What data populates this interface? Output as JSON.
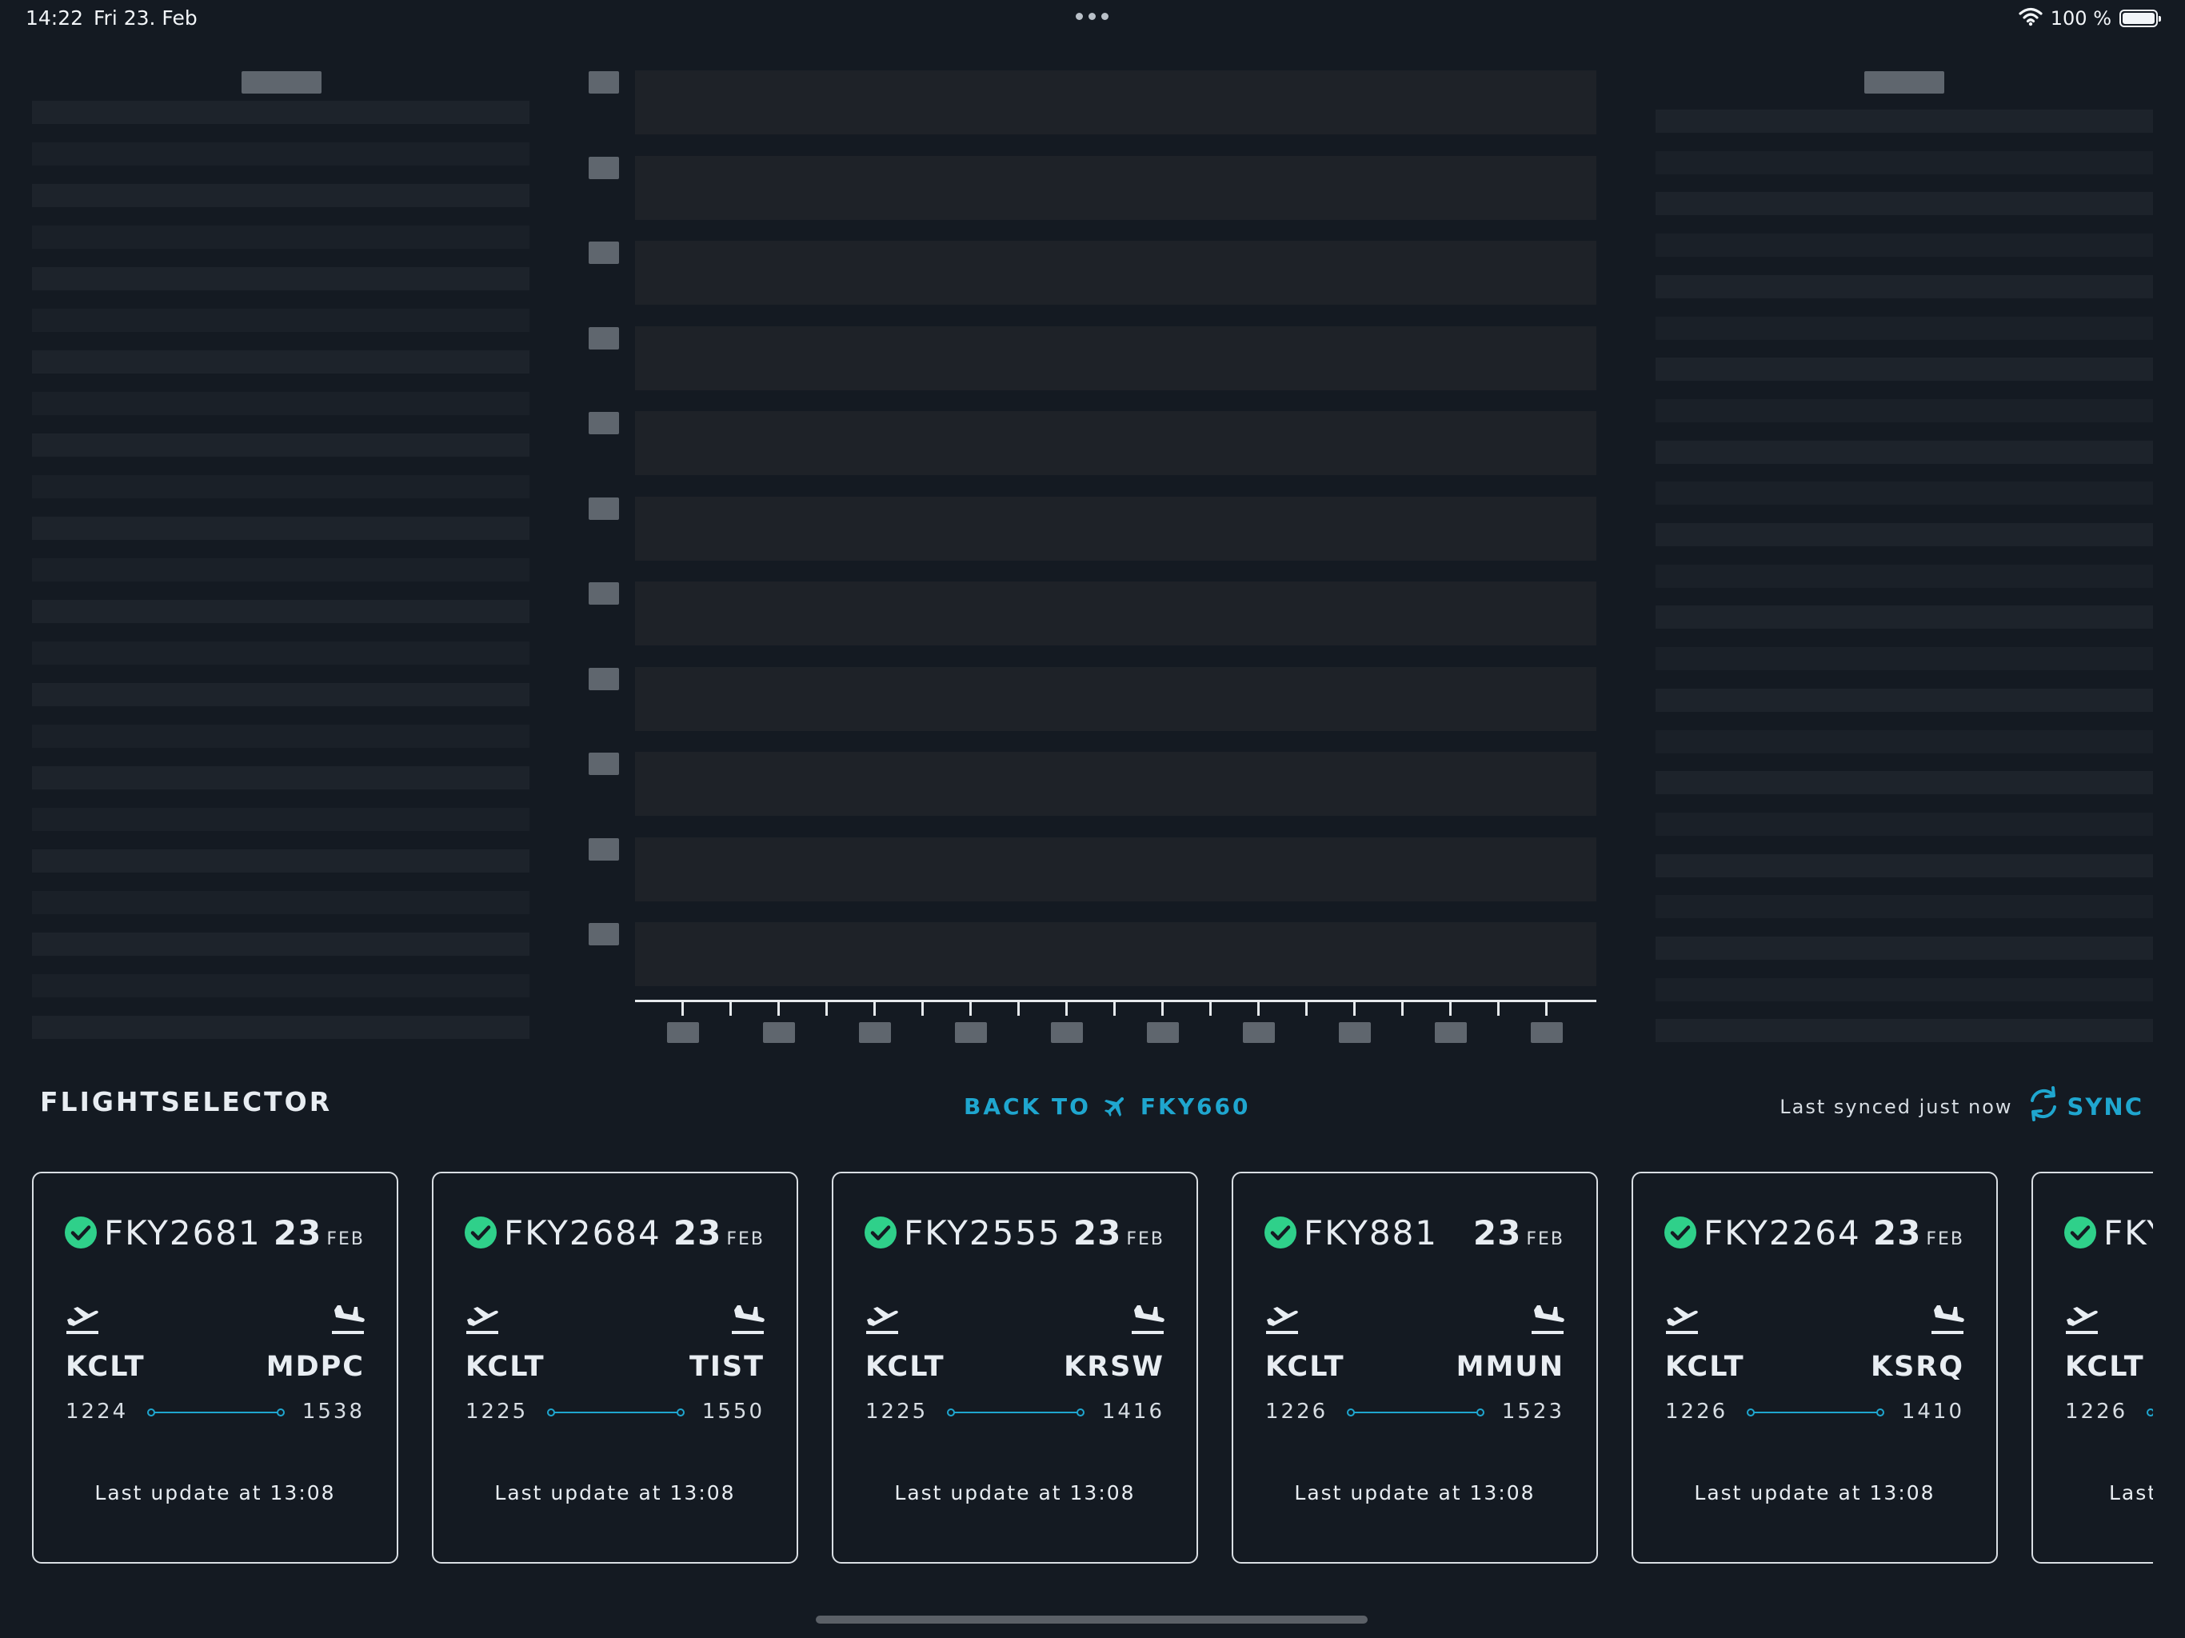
{
  "status_bar": {
    "time": "14:22",
    "date": "Fri 23. Feb",
    "battery_percent": "100 %",
    "battery_level": 1.0
  },
  "back_to": {
    "label": "BACK TO",
    "flight": "FKY660"
  },
  "flight_selector": {
    "title": "FLIGHTSELECTOR",
    "last_synced": "Last synced just now",
    "sync_label": "SYNC"
  },
  "colors": {
    "background": "#141a22",
    "accent": "#1fa6cf",
    "status_ok": "#2fd08a",
    "text": "#e8edf2"
  },
  "flights": [
    {
      "id": "FKY2681",
      "day": "23",
      "month": "FEB",
      "origin": "KCLT",
      "dest": "MDPC",
      "dep_time": "1224",
      "arr_time": "1538",
      "update": "Last update at 13:08",
      "status_icon": "check-circle-icon"
    },
    {
      "id": "FKY2684",
      "day": "23",
      "month": "FEB",
      "origin": "KCLT",
      "dest": "TIST",
      "dep_time": "1225",
      "arr_time": "1550",
      "update": "Last update at 13:08",
      "status_icon": "check-circle-icon"
    },
    {
      "id": "FKY2555",
      "day": "23",
      "month": "FEB",
      "origin": "KCLT",
      "dest": "KRSW",
      "dep_time": "1225",
      "arr_time": "1416",
      "update": "Last update at 13:08",
      "status_icon": "check-circle-icon"
    },
    {
      "id": "FKY881",
      "day": "23",
      "month": "FEB",
      "origin": "KCLT",
      "dest": "MMUN",
      "dep_time": "1226",
      "arr_time": "1523",
      "update": "Last update at 13:08",
      "status_icon": "check-circle-icon"
    },
    {
      "id": "FKY2264",
      "day": "23",
      "month": "FEB",
      "origin": "KCLT",
      "dest": "KSRQ",
      "dep_time": "1226",
      "arr_time": "1410",
      "update": "Last update at 13:08",
      "status_icon": "check-circle-icon"
    },
    {
      "id": "FKY",
      "day": "",
      "month": "",
      "origin": "KCLT",
      "dest": "",
      "dep_time": "1226",
      "arr_time": "",
      "update": "Last",
      "status_icon": "check-circle-icon"
    }
  ]
}
